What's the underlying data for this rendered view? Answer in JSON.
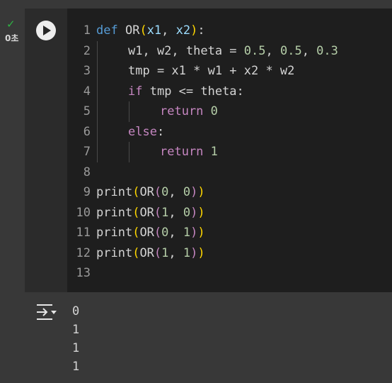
{
  "status": {
    "check_icon": "check-icon",
    "time_label": "0초"
  },
  "run_button": {
    "icon": "play-icon"
  },
  "code": {
    "lines": [
      {
        "n": "1",
        "t": [
          [
            "kw-def",
            "def"
          ],
          [
            "op",
            " OR"
          ],
          [
            "paren",
            "("
          ],
          [
            "param",
            "x1"
          ],
          [
            "op",
            ", "
          ],
          [
            "param",
            "x2"
          ],
          [
            "paren",
            ")"
          ],
          [
            "op",
            ":"
          ]
        ],
        "indent": 0
      },
      {
        "n": "2",
        "t": [
          [
            "op",
            "w1, w2, theta = "
          ],
          [
            "num",
            "0.5"
          ],
          [
            "op",
            ", "
          ],
          [
            "num",
            "0.5"
          ],
          [
            "op",
            ", "
          ],
          [
            "num",
            "0.3"
          ]
        ],
        "indent": 1
      },
      {
        "n": "3",
        "t": [
          [
            "op",
            "tmp = x1 * w1 + x2 * w2"
          ]
        ],
        "indent": 1
      },
      {
        "n": "4",
        "t": [
          [
            "kw",
            "if"
          ],
          [
            "op",
            " tmp <= theta:"
          ]
        ],
        "indent": 1
      },
      {
        "n": "5",
        "t": [
          [
            "kw",
            "return"
          ],
          [
            "op",
            " "
          ],
          [
            "num",
            "0"
          ]
        ],
        "indent": 2
      },
      {
        "n": "6",
        "t": [
          [
            "kw",
            "else"
          ],
          [
            "op",
            ":"
          ]
        ],
        "indent": 1
      },
      {
        "n": "7",
        "t": [
          [
            "kw",
            "return"
          ],
          [
            "op",
            " "
          ],
          [
            "num",
            "1"
          ]
        ],
        "indent": 2
      },
      {
        "n": "8",
        "t": [],
        "indent": 0
      },
      {
        "n": "9",
        "t": [
          [
            "op",
            "print"
          ],
          [
            "paren",
            "("
          ],
          [
            "op",
            "OR"
          ],
          [
            "kw",
            "("
          ],
          [
            "num",
            "0"
          ],
          [
            "op",
            ", "
          ],
          [
            "num",
            "0"
          ],
          [
            "kw",
            ")"
          ],
          [
            "paren",
            ")"
          ]
        ],
        "indent": 0
      },
      {
        "n": "10",
        "t": [
          [
            "op",
            "print"
          ],
          [
            "paren",
            "("
          ],
          [
            "op",
            "OR"
          ],
          [
            "kw",
            "("
          ],
          [
            "num",
            "1"
          ],
          [
            "op",
            ", "
          ],
          [
            "num",
            "0"
          ],
          [
            "kw",
            ")"
          ],
          [
            "paren",
            ")"
          ]
        ],
        "indent": 0
      },
      {
        "n": "11",
        "t": [
          [
            "op",
            "print"
          ],
          [
            "paren",
            "("
          ],
          [
            "op",
            "OR"
          ],
          [
            "kw",
            "("
          ],
          [
            "num",
            "0"
          ],
          [
            "op",
            ", "
          ],
          [
            "num",
            "1"
          ],
          [
            "kw",
            ")"
          ],
          [
            "paren",
            ")"
          ]
        ],
        "indent": 0
      },
      {
        "n": "12",
        "t": [
          [
            "op",
            "print"
          ],
          [
            "paren",
            "("
          ],
          [
            "op",
            "OR"
          ],
          [
            "kw",
            "("
          ],
          [
            "num",
            "1"
          ],
          [
            "op",
            ", "
          ],
          [
            "num",
            "1"
          ],
          [
            "kw",
            ")"
          ],
          [
            "paren",
            ")"
          ]
        ],
        "indent": 0
      },
      {
        "n": "13",
        "t": [],
        "indent": 0
      }
    ]
  },
  "output": {
    "icon": "output-toggle-icon",
    "lines": [
      "0",
      "1",
      "1",
      "1"
    ]
  },
  "colors": {
    "accent_check": "#2fb344",
    "keyword_def": "#569cd6",
    "keyword": "#c586c0",
    "number": "#b5cea8",
    "bracket": "#ffd700",
    "parameter": "#9cdcfe"
  }
}
